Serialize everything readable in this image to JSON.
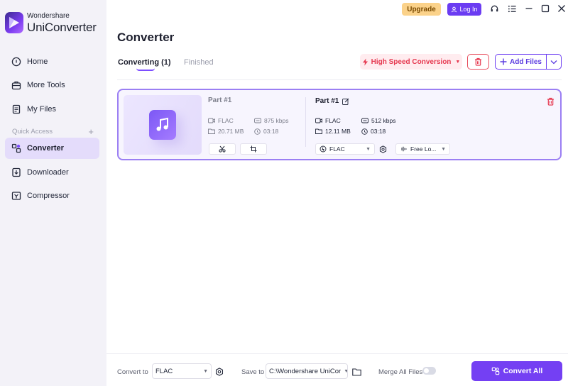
{
  "app": {
    "brand_small": "Wondershare",
    "brand_big": "UniConverter"
  },
  "sidebar": {
    "items": [
      {
        "label": "Home",
        "icon": "home-icon"
      },
      {
        "label": "More Tools",
        "icon": "toolbox-icon"
      },
      {
        "label": "My Files",
        "icon": "file-icon"
      },
      {
        "label": "Converter",
        "icon": "converter-icon",
        "active": true
      },
      {
        "label": "Downloader",
        "icon": "download-icon"
      },
      {
        "label": "Compressor",
        "icon": "compress-icon"
      }
    ],
    "quick_access": "Quick Access",
    "quick_access_add": "+"
  },
  "topbar": {
    "upgrade_label": "Upgrade",
    "login_label": "Log In"
  },
  "main": {
    "title": "Converter",
    "tabs": [
      {
        "label": "Converting (1)",
        "active": true
      },
      {
        "label": "Finished",
        "active": false
      }
    ],
    "high_speed_label": "High Speed Conversion",
    "add_files_label": "Add Files"
  },
  "file": {
    "source": {
      "name": "Part #1",
      "format": "FLAC",
      "bitrate": "875 kbps",
      "size": "20.71 MB",
      "duration": "03:18"
    },
    "target": {
      "name": "Part #1",
      "format": "FLAC",
      "bitrate": "512 kbps",
      "size": "12.11 MB",
      "duration": "03:18"
    },
    "output_format": "FLAC",
    "audio_setting": "Free Lo..."
  },
  "bottom": {
    "convert_to_label": "Convert to",
    "convert_to_value": "FLAC",
    "save_to_label": "Save to",
    "save_to_value": "C:\\Wondershare UniCor",
    "merge_label": "Merge All Files",
    "merge_enabled": false,
    "convert_all_label": "Convert All"
  },
  "colors": {
    "accent": "#7440f3",
    "upgrade": "#fbd28a",
    "danger": "#e63950",
    "sidebar_bg": "#f3f2f8"
  }
}
